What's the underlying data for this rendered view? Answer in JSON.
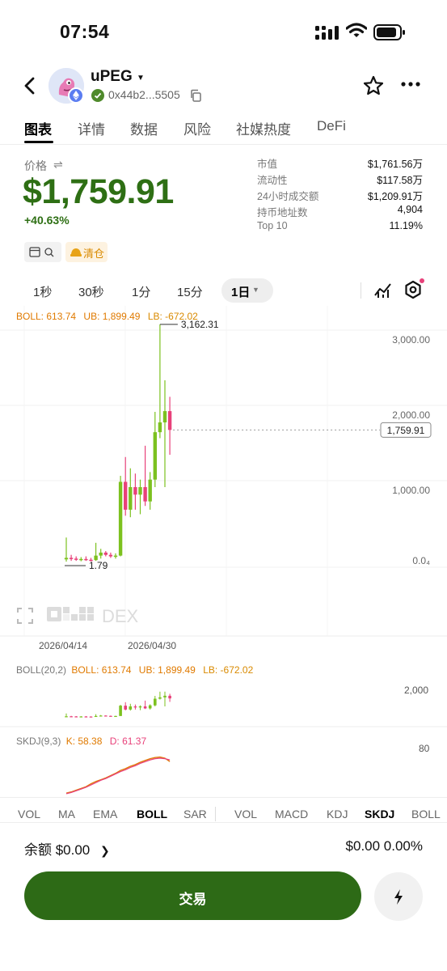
{
  "status_bar": {
    "time": "07:54"
  },
  "header": {
    "token_name": "uPEG",
    "address": "0x44b2...5505"
  },
  "tabs": [
    "图表",
    "详情",
    "数据",
    "风险",
    "社媒热度",
    "DeFi"
  ],
  "price_block": {
    "label": "价格",
    "price": "$1,759.91",
    "change": "+40.63%",
    "clear_label": "清仓"
  },
  "stats": [
    {
      "label": "市值",
      "value": "$1,761.56万"
    },
    {
      "label": "流动性",
      "value": "$117.58万"
    },
    {
      "label": "24小时成交额",
      "value": "$1,209.91万"
    },
    {
      "label": "持币地址数",
      "value": "4,904"
    },
    {
      "label": "Top 10",
      "value": "11.19%"
    }
  ],
  "timeframes": [
    "1秒",
    "30秒",
    "1分",
    "15分"
  ],
  "timeframe_active": "1日",
  "main_chart": {
    "boll_label": "BOLL: 613.74",
    "ub_label": "UB: 1,899.49",
    "lb_label": "LB: -672.02",
    "high_label": "3,162.31",
    "low_label": "1.79",
    "current_label": "1,759.91",
    "watermark": "DEX",
    "dates": [
      "2026/04/14",
      "2026/04/30"
    ]
  },
  "boll_panel": {
    "name": "BOLL(20,2)",
    "boll": "BOLL: 613.74",
    "ub": "UB: 1,899.49",
    "lb": "LB: -672.02",
    "axis": "2,000"
  },
  "skdj_panel": {
    "name": "SKDJ(9,3)",
    "k": "K: 58.38",
    "d": "D: 61.37",
    "axis": "80"
  },
  "indicator_tabs_main": [
    "VOL",
    "MA",
    "EMA",
    "BOLL",
    "SAR"
  ],
  "indicator_tabs_sub": [
    "VOL",
    "MACD",
    "KDJ",
    "SKDJ",
    "BOLL"
  ],
  "balance": {
    "label": "余额 $0.00",
    "right": "$0.00 0.00%"
  },
  "trade_button": "交易",
  "colors": {
    "up": "#7cc11f",
    "down": "#e8417a",
    "accent": "#2d6a16",
    "boll": "#e07a00",
    "lb": "#d98a00"
  },
  "chart_data": {
    "type": "candlestick",
    "y_ticks": [
      "3,000.00",
      "2,000.00",
      "1,000.00",
      "0.0₄"
    ],
    "ylim": [
      0,
      3250
    ],
    "x_labels": [
      "2026/04/14",
      "2026/04/30"
    ],
    "candles": [
      {
        "o": 40,
        "h": 330,
        "l": 10,
        "c": 60
      },
      {
        "o": 60,
        "h": 100,
        "l": 20,
        "c": 50
      },
      {
        "o": 50,
        "h": 80,
        "l": 20,
        "c": 40
      },
      {
        "o": 40,
        "h": 70,
        "l": 15,
        "c": 45
      },
      {
        "o": 45,
        "h": 80,
        "l": 20,
        "c": 35
      },
      {
        "o": 35,
        "h": 60,
        "l": 10,
        "c": 30
      },
      {
        "o": 30,
        "h": 260,
        "l": 20,
        "c": 90
      },
      {
        "o": 90,
        "h": 180,
        "l": 50,
        "c": 130
      },
      {
        "o": 130,
        "h": 150,
        "l": 80,
        "c": 100
      },
      {
        "o": 100,
        "h": 130,
        "l": 60,
        "c": 80
      },
      {
        "o": 80,
        "h": 120,
        "l": 50,
        "c": 90
      },
      {
        "o": 90,
        "h": 1150,
        "l": 80,
        "c": 1070
      },
      {
        "o": 1070,
        "h": 1400,
        "l": 620,
        "c": 700
      },
      {
        "o": 700,
        "h": 1250,
        "l": 600,
        "c": 1000
      },
      {
        "o": 1000,
        "h": 1180,
        "l": 700,
        "c": 900
      },
      {
        "o": 900,
        "h": 1100,
        "l": 640,
        "c": 1000
      },
      {
        "o": 1000,
        "h": 1550,
        "l": 750,
        "c": 810
      },
      {
        "o": 810,
        "h": 1200,
        "l": 700,
        "c": 1100
      },
      {
        "o": 1100,
        "h": 2000,
        "l": 1000,
        "c": 1730
      },
      {
        "o": 1730,
        "h": 3162.31,
        "l": 1650,
        "c": 1860
      },
      {
        "o": 1860,
        "h": 2420,
        "l": 1000,
        "c": 2010
      },
      {
        "o": 2010,
        "h": 2200,
        "l": 1430,
        "c": 1759.91
      }
    ],
    "high": 3162.31,
    "low": 1.79,
    "last": 1759.91
  }
}
